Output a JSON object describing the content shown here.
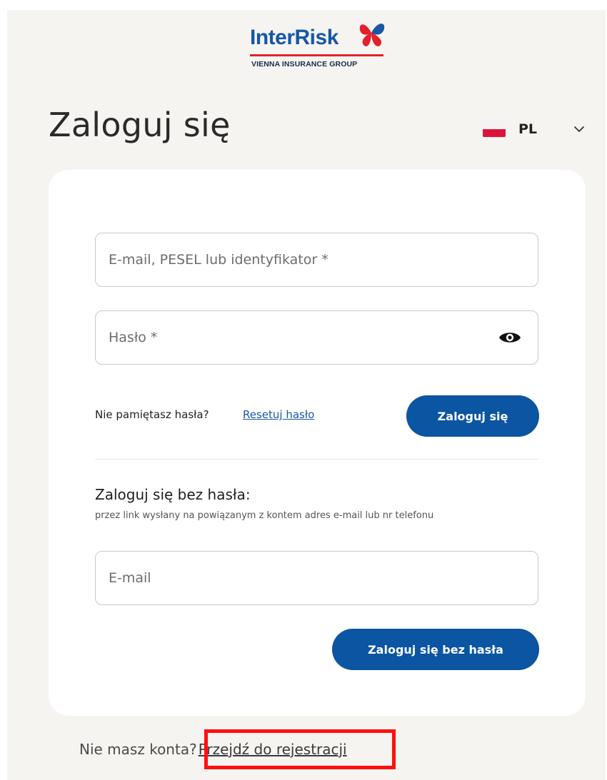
{
  "logo": {
    "brand": "InterRisk",
    "group": "VIENNA INSURANCE GROUP",
    "colors": {
      "blue": "#1757a5",
      "red": "#e3202b"
    }
  },
  "header": {
    "title": "Zaloguj się",
    "language": {
      "code": "PL",
      "flag": "poland-flag-icon",
      "chevron": "chevron-down-icon"
    }
  },
  "login_form": {
    "identifier_placeholder": "E-mail, PESEL lub identyfikator *",
    "password_placeholder": "Hasło *",
    "password_toggle_icon": "eye-icon",
    "forgot_text": "Nie pamiętasz hasła?",
    "reset_link": "Resetuj hasło",
    "submit_label": "Zaloguj się"
  },
  "passwordless": {
    "title": "Zaloguj się bez hasła:",
    "description": "przez link wysłany na powiązanym z kontem adres e-mail lub nr telefonu",
    "email_placeholder": "E-mail",
    "submit_label": "Zaloguj się bez hasła"
  },
  "footer": {
    "no_account_text": "Nie masz konta?",
    "register_link": "Przejdź do rejestracji"
  },
  "colors": {
    "primary_button": "#0b55a2",
    "link": "#1c56a4",
    "page_background": "#f5f4f1",
    "highlight": "#ff1010"
  }
}
